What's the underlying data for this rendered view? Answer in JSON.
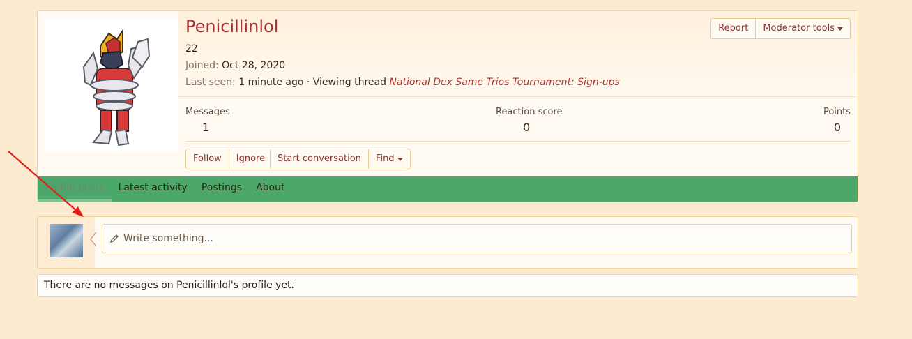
{
  "profile": {
    "username": "Penicillinlol",
    "age": "22",
    "joined_label": "Joined:",
    "joined_value": "Oct 28, 2020",
    "last_seen_label": "Last seen:",
    "last_seen_value": "1 minute ago · Viewing thread",
    "last_seen_thread": "National Dex Same Trios Tournament: Sign-ups"
  },
  "header_buttons": {
    "report": "Report",
    "moderator_tools": "Moderator tools"
  },
  "stats": [
    {
      "label": "Messages",
      "value": "1"
    },
    {
      "label": "Reaction score",
      "value": "0"
    },
    {
      "label": "Points",
      "value": "0"
    }
  ],
  "actions": {
    "follow": "Follow",
    "ignore": "Ignore",
    "start_conversation": "Start conversation",
    "find": "Find"
  },
  "tabs": [
    "Profile posts",
    "Latest activity",
    "Postings",
    "About"
  ],
  "composer": {
    "placeholder": "Write something..."
  },
  "empty_message": "There are no messages on Penicillinlol's profile yet.",
  "colors": {
    "accent": "#a8322e",
    "tabbar": "#4ba86a",
    "background": "#fdebd1",
    "annotation_arrow": "#e0201a"
  },
  "icons": {
    "pencil": "pencil-icon",
    "caret": "caret-down-icon"
  }
}
